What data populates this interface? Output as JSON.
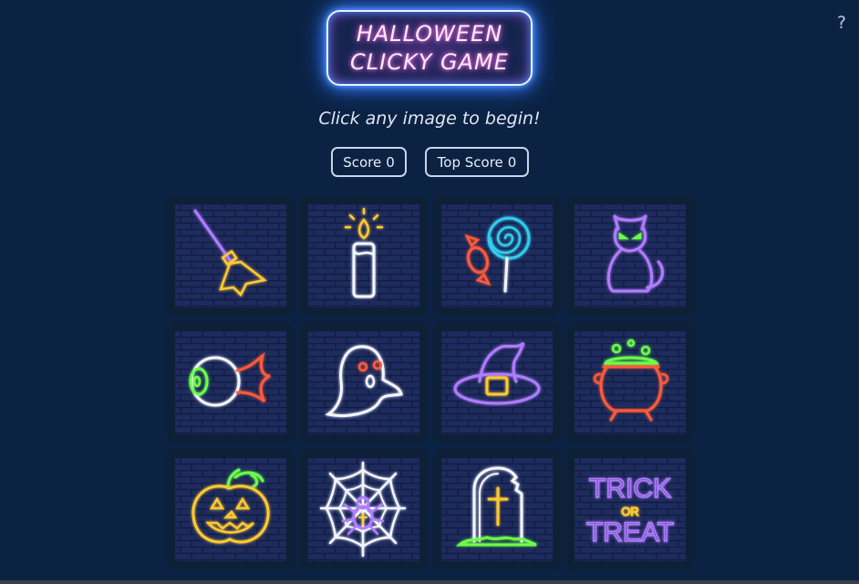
{
  "game": {
    "title_line1": "HALLOWEEN",
    "title_line2": "CLICKY GAME",
    "help_label": "?",
    "instruction": "Click any image to begin!",
    "score_label": "Score",
    "score_value": "0",
    "top_score_label": "Top Score",
    "top_score_value": "0"
  },
  "colors": {
    "background": "#0b2243",
    "brick": "#1c2a5c",
    "neon_blue": "#4a8cff",
    "neon_pink": "#ff7ad9"
  },
  "cards": [
    {
      "icon": "broom-icon"
    },
    {
      "icon": "candle-icon"
    },
    {
      "icon": "candy-lollipop-icon"
    },
    {
      "icon": "black-cat-icon"
    },
    {
      "icon": "eyeball-icon"
    },
    {
      "icon": "ghost-icon"
    },
    {
      "icon": "witch-hat-icon"
    },
    {
      "icon": "cauldron-icon"
    },
    {
      "icon": "jack-o-lantern-icon"
    },
    {
      "icon": "spider-web-icon"
    },
    {
      "icon": "tombstone-icon"
    },
    {
      "icon": "trick-or-treat-icon",
      "text_top": "TRICK",
      "text_mid": "OR",
      "text_bottom": "TREAT"
    }
  ]
}
